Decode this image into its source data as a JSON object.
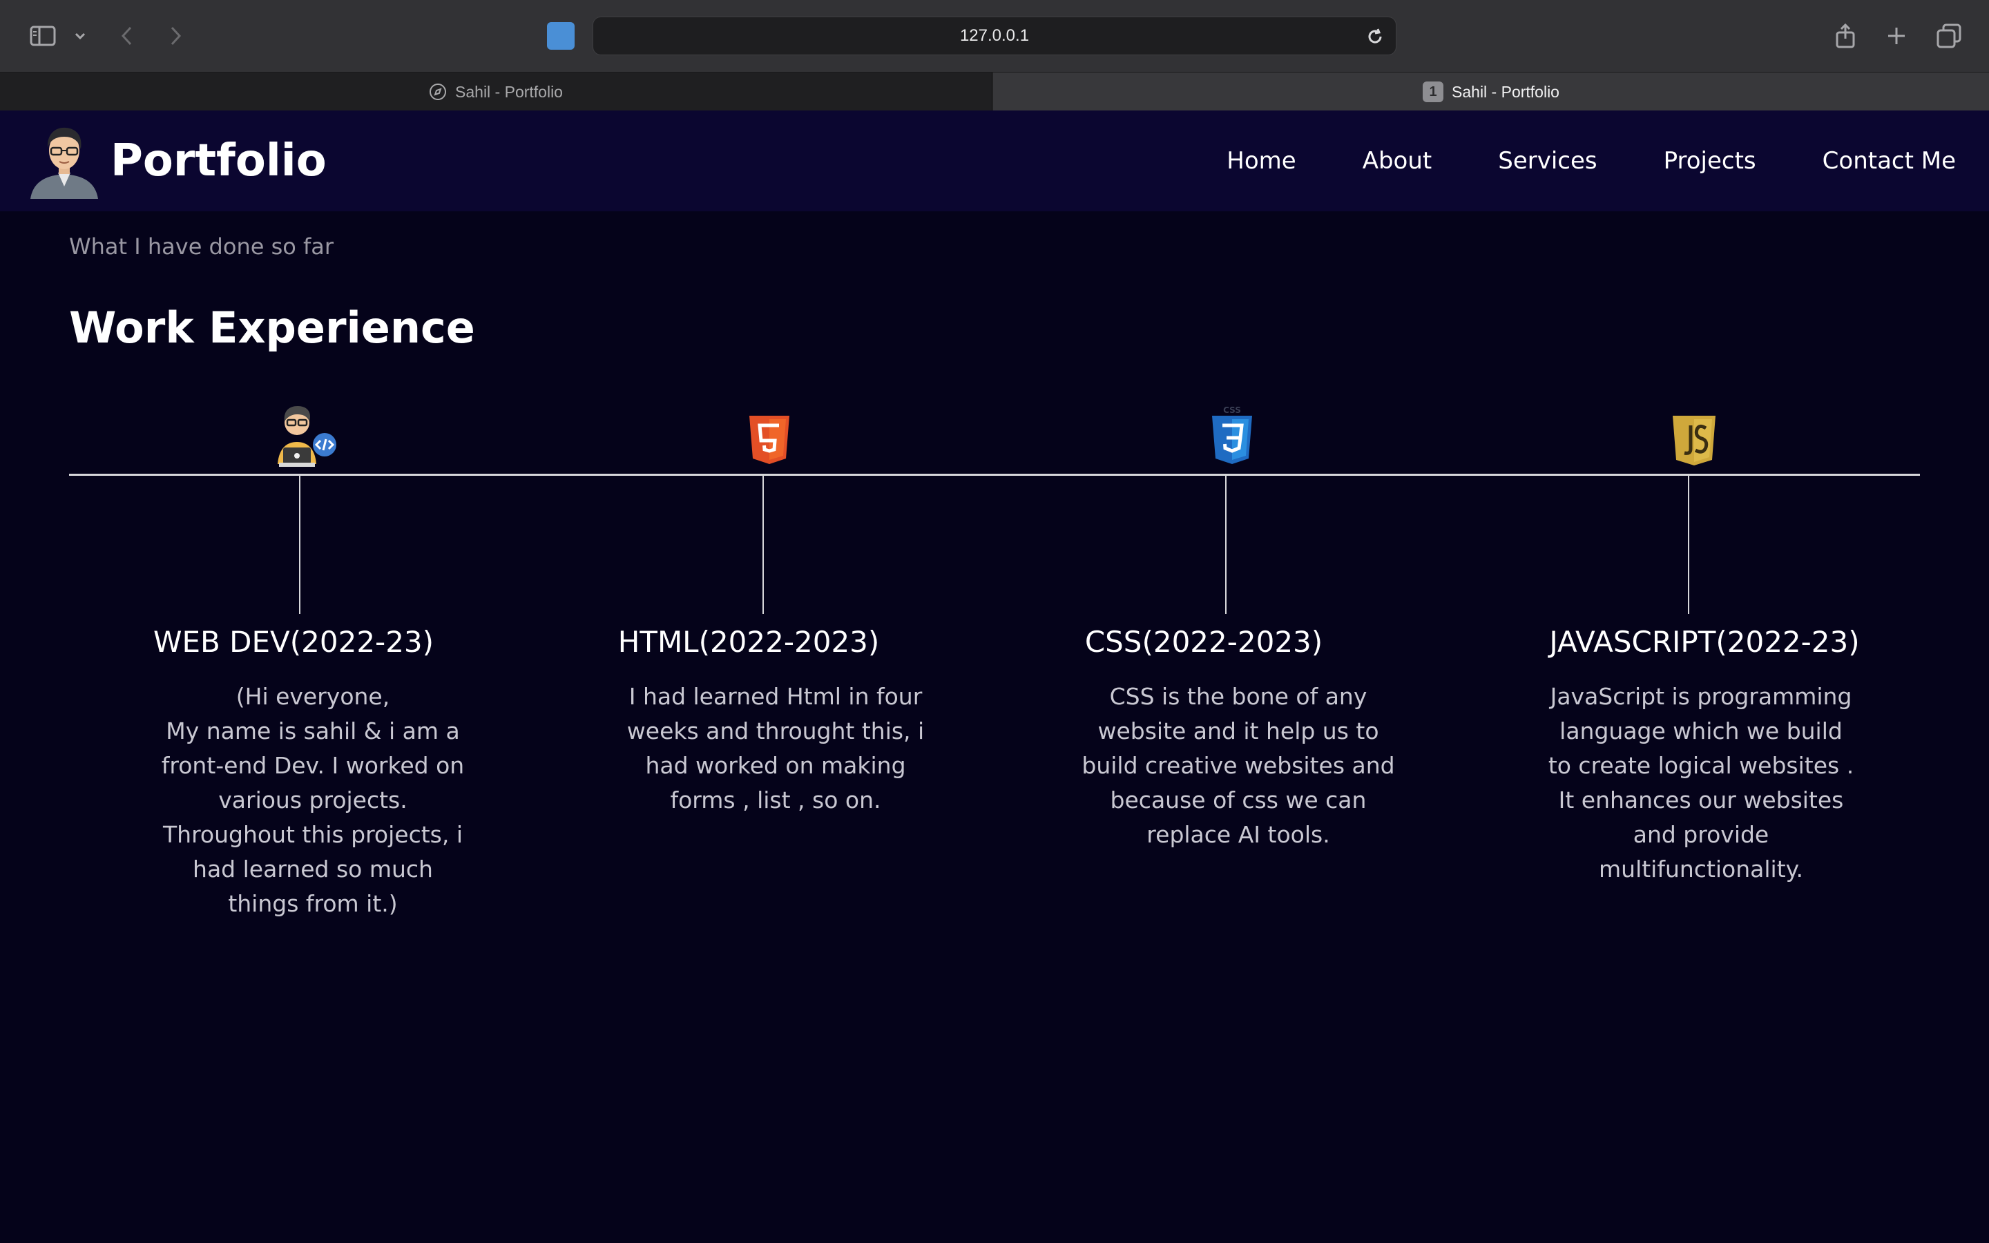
{
  "browser": {
    "url": "127.0.0.1",
    "tabs": [
      {
        "label": "Sahil - Portfolio",
        "active": false
      },
      {
        "label": "Sahil - Portfolio",
        "active": true,
        "badge": "1"
      }
    ]
  },
  "navbar": {
    "logo_text": "Portfolio",
    "links": [
      "Home",
      "About",
      "Services",
      "Projects",
      "Contact Me"
    ]
  },
  "section": {
    "subtitle": "What I have done so far",
    "heading": "Work Experience"
  },
  "timeline": [
    {
      "icon": "developer-icon",
      "title": "WEB DEV(2022-23)",
      "description": "(Hi everyone,\nMy name is sahil & i am a\nfront-end Dev. I worked on\nvarious projects.\nThroughout this projects, i\nhad learned so much\nthings from it.)"
    },
    {
      "icon": "html5-icon",
      "title": "HTML(2022-2023)",
      "description": "I had learned Html in four\nweeks and throught this, i\nhad worked on making\nforms , list , so on."
    },
    {
      "icon": "css3-icon",
      "title": "CSS(2022-2023)",
      "description": "CSS is the bone of any\nwebsite and it help us to\nbuild creative websites and\nbecause of css we can\nreplace AI tools."
    },
    {
      "icon": "javascript-icon",
      "title": "JAVASCRIPT(2022-23)",
      "description": "JavaScript is programming\nlanguage which we build\nto create logical websites .\nIt enhances our websites\nand provide\nmultifunctionality."
    }
  ],
  "colors": {
    "page_bg": "#05031a",
    "navbar_bg": "#0b0630",
    "html5": "#e34f26",
    "css3": "#1f6bc2",
    "javascript": "#cfa83b"
  }
}
